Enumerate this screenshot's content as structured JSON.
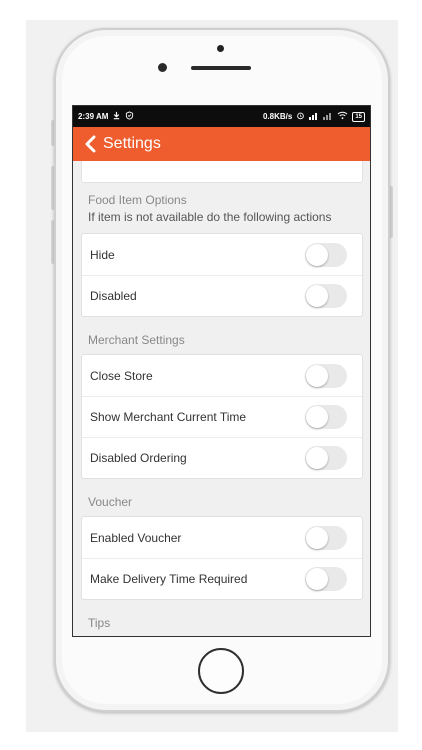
{
  "status_bar": {
    "time": "2:39 AM",
    "network_speed": "0.8KB/s",
    "battery_level": "15"
  },
  "app_bar": {
    "title": "Settings",
    "back_icon": "chevron-left-icon"
  },
  "sections": [
    {
      "label": "Food Item Options",
      "subtitle": "If item is not available do the following actions",
      "items": [
        {
          "label": "Hide",
          "enabled": false
        },
        {
          "label": "Disabled",
          "enabled": false
        }
      ]
    },
    {
      "label": "Merchant Settings",
      "items": [
        {
          "label": "Close Store",
          "enabled": false
        },
        {
          "label": "Show Merchant Current Time",
          "enabled": false
        },
        {
          "label": "Disabled Ordering",
          "enabled": false
        }
      ]
    },
    {
      "label": "Voucher",
      "items": [
        {
          "label": "Enabled Voucher",
          "enabled": false
        },
        {
          "label": "Make Delivery Time Required",
          "enabled": false
        }
      ]
    },
    {
      "label": "Tips",
      "items": []
    }
  ],
  "colors": {
    "accent": "#ef5d2f",
    "status_bar": "#0d0d0d",
    "background": "#f0f0f0",
    "toggle_off": "#e9e9e9"
  }
}
